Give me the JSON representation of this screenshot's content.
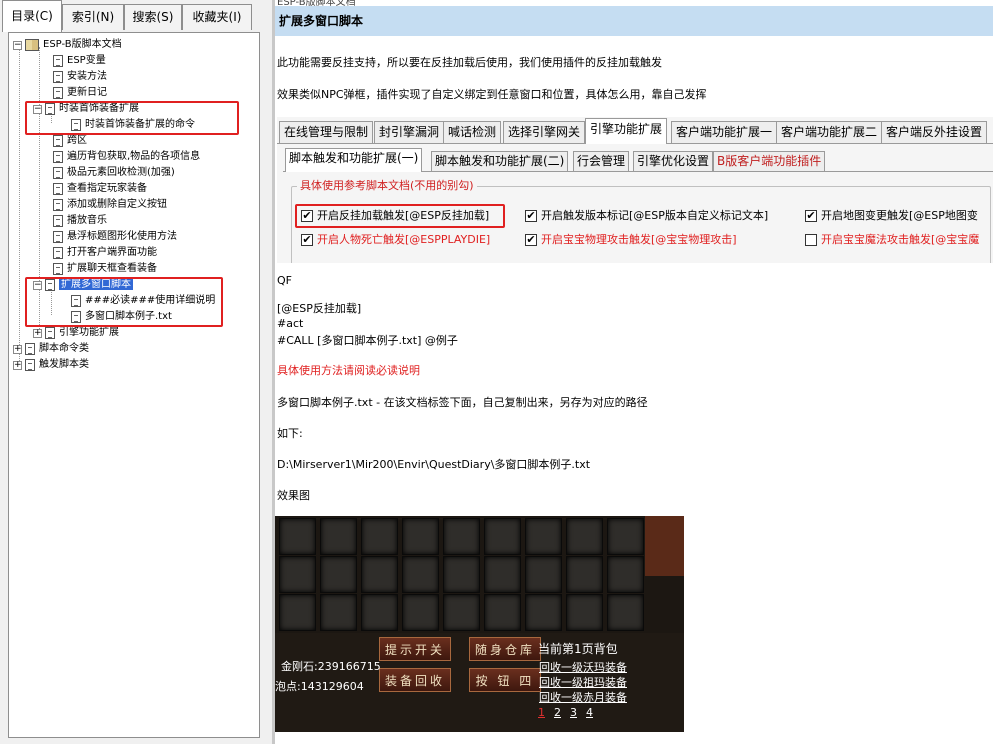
{
  "left_tabs": [
    "目录(C)",
    "索引(N)",
    "搜索(S)",
    "收藏夹(I)"
  ],
  "tree": [
    {
      "label": "ESP-B版脚本文档",
      "pm": "−",
      "icon": "book"
    },
    {
      "label": "ESP变量",
      "icon": "doc"
    },
    {
      "label": "安装方法",
      "icon": "doc"
    },
    {
      "label": "更新日记",
      "icon": "doc"
    },
    {
      "label": "时装首饰装备扩展",
      "pm": "−",
      "icon": "doc"
    },
    {
      "label": "时装首饰装备扩展的命令",
      "icon": "doc"
    },
    {
      "label": "跨区",
      "icon": "doc"
    },
    {
      "label": "遍历背包获取,物品的各项信息",
      "icon": "doc"
    },
    {
      "label": "极品元素回收检测(加强)",
      "icon": "doc"
    },
    {
      "label": "查看指定玩家装备",
      "icon": "doc"
    },
    {
      "label": "添加或删除自定义按钮",
      "icon": "doc"
    },
    {
      "label": "播放音乐",
      "icon": "doc"
    },
    {
      "label": "悬浮标题图形化使用方法",
      "icon": "doc"
    },
    {
      "label": "打开客户端界面功能",
      "icon": "doc"
    },
    {
      "label": "扩展聊天框查看装备",
      "icon": "doc"
    },
    {
      "label": "扩展多窗口脚本",
      "pm": "−",
      "icon": "doc",
      "selected": true
    },
    {
      "label": "###必读###使用详细说明",
      "icon": "doc"
    },
    {
      "label": "多窗口脚本例子.txt",
      "icon": "doc"
    },
    {
      "label": "引擎功能扩展",
      "pm": "+",
      "icon": "doc"
    },
    {
      "label": "脚本命令类",
      "pm": "+",
      "icon": "doc"
    },
    {
      "label": "触发脚本类",
      "pm": "+",
      "icon": "doc"
    }
  ],
  "right": {
    "breadcrumb": "ESP-B版脚本文档",
    "title": "扩展多窗口脚本",
    "p1": "此功能需要反挂支持，所以要在反挂加载后使用，我们使用插件的反挂加载触发",
    "p2": "效果类似NPC弹框，插件实现了自定义绑定到任意窗口和位置，具体怎么用，靠自己发挥",
    "dialog": {
      "tabs1": [
        "在线管理与限制",
        "封引擎漏洞",
        "喊话检测",
        "选择引擎网关",
        "引擎功能扩展",
        "客户端功能扩展一",
        "客户端功能扩展二",
        "客户端反外挂设置"
      ],
      "tabs2": [
        "脚本触发和功能扩展(一)",
        "脚本触发和功能扩展(二)",
        "行会管理",
        "引擎优化设置",
        "B版客户端功能插件"
      ],
      "group_title": "具体使用参考脚本文档(不用的别勾)",
      "checkboxes_row1": [
        {
          "label": "开启反挂加载触发[@ESP反挂加载]",
          "checked": true
        },
        {
          "label": "开启触发版本标记[@ESP版本自定义标记文本]",
          "checked": true
        },
        {
          "label": "开启地图变更触发[@ESP地图变",
          "checked": true
        }
      ],
      "checkboxes_row2": [
        {
          "label": "开启人物死亡触发[@ESPPLAYDIE]",
          "checked": true
        },
        {
          "label": "开启宝宝物理攻击触发[@宝宝物理攻击]",
          "checked": true
        },
        {
          "label": "开启宝宝魔法攻击触发[@宝宝魔",
          "checked": false
        }
      ]
    },
    "code": {
      "l1": "QF",
      "l2": "[@ESP反挂加载]",
      "l3": "#act",
      "l4": "#CALL [多窗口脚本例子.txt] @例子"
    },
    "red_note": "具体使用方法请阅读必读说明",
    "p3": "多窗口脚本例子.txt - 在该文档标签下面，自己复制出来，另存为对应的路径",
    "p4": "如下:",
    "p5": "D:\\Mirserver1\\Mir200\\Envir\\QuestDiary\\多窗口脚本例子.txt",
    "p6": "效果图",
    "game": {
      "btn1": "提示开关",
      "btn2": "随身仓库",
      "btn3": "装备回收",
      "btn4": "按 钮 四",
      "bag_title": "当前第1页背包",
      "diamond": "金刚石:239166715",
      "bubble": "泡点:143129604",
      "links": [
        "回收一级沃玛装备",
        "回收一级祖玛装备",
        "回收一级赤月装备"
      ],
      "pages": [
        "1",
        "2",
        "3",
        "4"
      ]
    }
  }
}
